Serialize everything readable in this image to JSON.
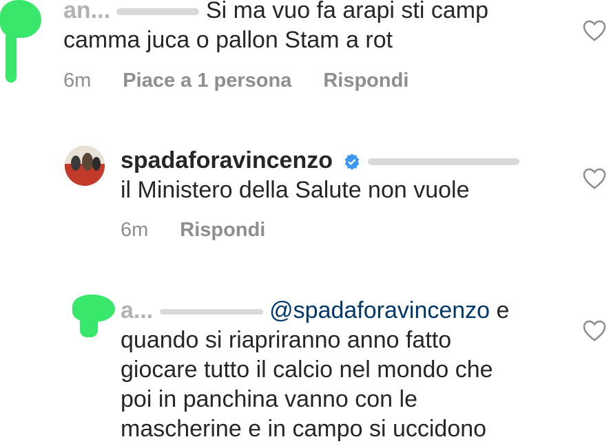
{
  "comments": [
    {
      "username": "an...",
      "text_line1": "Si ma vuo fa arapi sti camp",
      "text_line2": "camma juca o pallon Stam a rot",
      "time": "6m",
      "likes": "Piace a 1 persona",
      "reply": "Rispondi"
    },
    {
      "username": "spadaforavincenzo",
      "text": "il Ministero della Salute non vuole",
      "time": "6m",
      "reply": "Rispondi"
    },
    {
      "username": "a...",
      "mention": "@spadaforavincenzo",
      "text_after_mention": " e",
      "lines": [
        "quando si riapriranno anno fatto",
        "giocare tutto il calcio nel mondo che",
        "poi in panchina vanno con le",
        "mascherine e in campo si uccidono"
      ]
    }
  ],
  "colors": {
    "text": "#262626",
    "meta": "#8e8e8e",
    "mention": "#00376b",
    "verified": "#3897f0",
    "highlight": "#39e86a"
  },
  "icons": {
    "like": "heart-outline-icon",
    "verified": "verified-badge-icon"
  }
}
